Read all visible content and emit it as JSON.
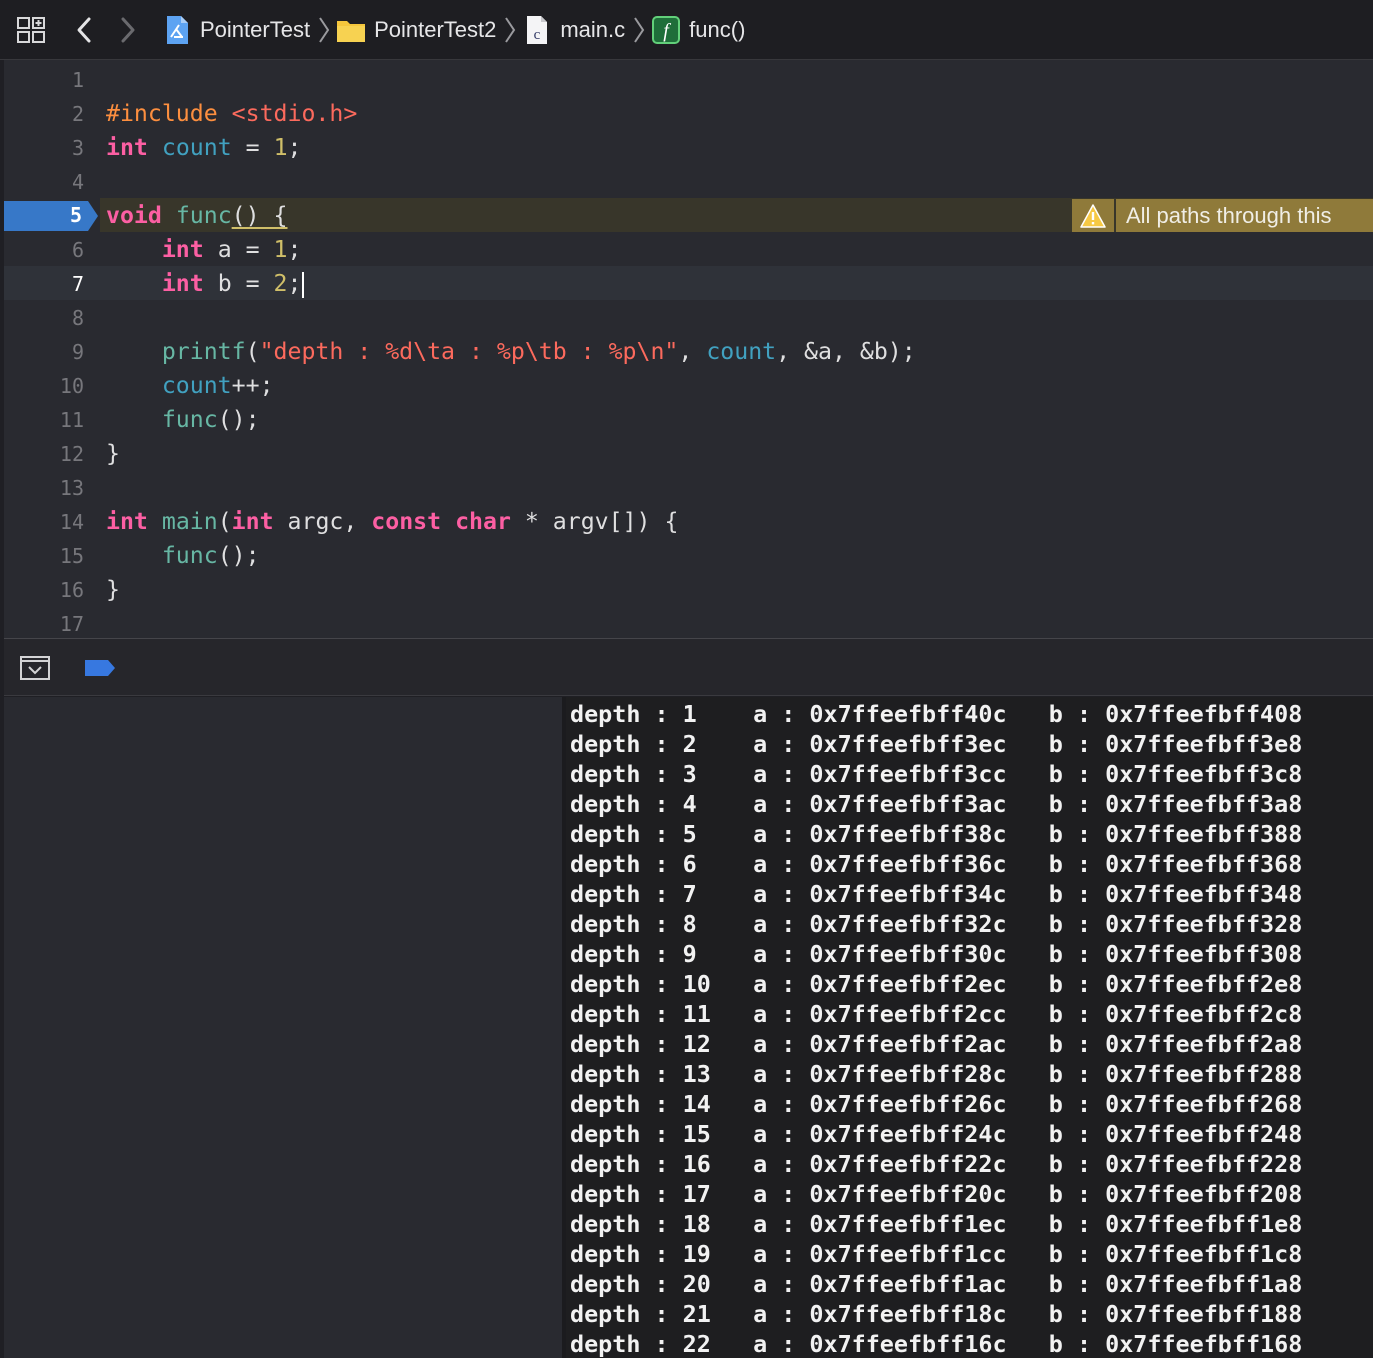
{
  "breadcrumbs": {
    "project": "PointerTest",
    "folder": "PointerTest2",
    "file": "main.c",
    "symbol": "func()"
  },
  "editor": {
    "line_numbers": [
      "1",
      "2",
      "3",
      "4",
      "5",
      "6",
      "7",
      "8",
      "9",
      "10",
      "11",
      "12",
      "13",
      "14",
      "15",
      "16",
      "17"
    ],
    "current_line": 7,
    "breakpoint_line": 5,
    "warning": {
      "line": 5,
      "text": "All paths through this"
    },
    "code": {
      "l2": {
        "pp": "#include",
        "hdr": "<stdio.h>"
      },
      "l3": {
        "kw": "int",
        "var": "count",
        "eq": " = ",
        "num": "1",
        "end": ";"
      },
      "l5": {
        "kw": "void",
        "fn": "func",
        "rest": "() {"
      },
      "l6": {
        "indent": "    ",
        "kw": "int",
        "rest": " a = ",
        "num": "1",
        "end": ";"
      },
      "l7": {
        "indent": "    ",
        "kw": "int",
        "rest": " b = ",
        "num": "2",
        "end": ";"
      },
      "l9": {
        "indent": "    ",
        "fn": "printf",
        "open": "(",
        "str": "\"depth : %d\\ta : %p\\tb : %p\\n\"",
        "comma": ", ",
        "var": "count",
        "rest": ", &a, &b);"
      },
      "l10": {
        "indent": "    ",
        "var": "count",
        "rest": "++;"
      },
      "l11": {
        "indent": "    ",
        "fn": "func",
        "rest": "();"
      },
      "l12": {
        "text": "}"
      },
      "l14": {
        "kw1": "int",
        "fn": "main",
        "p1": "(",
        "kw2": "int",
        "p2": " argc, ",
        "kw3": "const",
        "kw4": "char",
        "p3": " * argv[]) {"
      },
      "l15": {
        "indent": "    ",
        "fn": "func",
        "rest": "();"
      },
      "l16": {
        "text": "}"
      }
    }
  },
  "console": {
    "rows": [
      "depth : 1    a : 0x7ffeefbff40c   b : 0x7ffeefbff408",
      "depth : 2    a : 0x7ffeefbff3ec   b : 0x7ffeefbff3e8",
      "depth : 3    a : 0x7ffeefbff3cc   b : 0x7ffeefbff3c8",
      "depth : 4    a : 0x7ffeefbff3ac   b : 0x7ffeefbff3a8",
      "depth : 5    a : 0x7ffeefbff38c   b : 0x7ffeefbff388",
      "depth : 6    a : 0x7ffeefbff36c   b : 0x7ffeefbff368",
      "depth : 7    a : 0x7ffeefbff34c   b : 0x7ffeefbff348",
      "depth : 8    a : 0x7ffeefbff32c   b : 0x7ffeefbff328",
      "depth : 9    a : 0x7ffeefbff30c   b : 0x7ffeefbff308",
      "depth : 10   a : 0x7ffeefbff2ec   b : 0x7ffeefbff2e8",
      "depth : 11   a : 0x7ffeefbff2cc   b : 0x7ffeefbff2c8",
      "depth : 12   a : 0x7ffeefbff2ac   b : 0x7ffeefbff2a8",
      "depth : 13   a : 0x7ffeefbff28c   b : 0x7ffeefbff288",
      "depth : 14   a : 0x7ffeefbff26c   b : 0x7ffeefbff268",
      "depth : 15   a : 0x7ffeefbff24c   b : 0x7ffeefbff248",
      "depth : 16   a : 0x7ffeefbff22c   b : 0x7ffeefbff228",
      "depth : 17   a : 0x7ffeefbff20c   b : 0x7ffeefbff208",
      "depth : 18   a : 0x7ffeefbff1ec   b : 0x7ffeefbff1e8",
      "depth : 19   a : 0x7ffeefbff1cc   b : 0x7ffeefbff1c8",
      "depth : 20   a : 0x7ffeefbff1ac   b : 0x7ffeefbff1a8",
      "depth : 21   a : 0x7ffeefbff18c   b : 0x7ffeefbff188",
      "depth : 22   a : 0x7ffeefbff16c   b : 0x7ffeefbff168"
    ]
  },
  "icons": {
    "grid": "related-items-icon",
    "back": "chevron-left-icon",
    "forward": "chevron-right-icon",
    "project": "xcode-project-icon",
    "folder": "folder-icon",
    "file": "c-file-icon",
    "symbol": "function-icon",
    "warning": "warning-icon",
    "debug_toggle": "hide-debug-area-icon",
    "breakpoints": "breakpoint-toggle-icon"
  },
  "colors": {
    "keyword": "#fc5fa3",
    "preprocessor": "#fd8f3f",
    "string": "#fc6a5d",
    "number": "#d0bf69",
    "function": "#67b7a4",
    "global_var": "#41a1c0",
    "breakpoint": "#3778c8",
    "warning": "#8f7a3a"
  }
}
